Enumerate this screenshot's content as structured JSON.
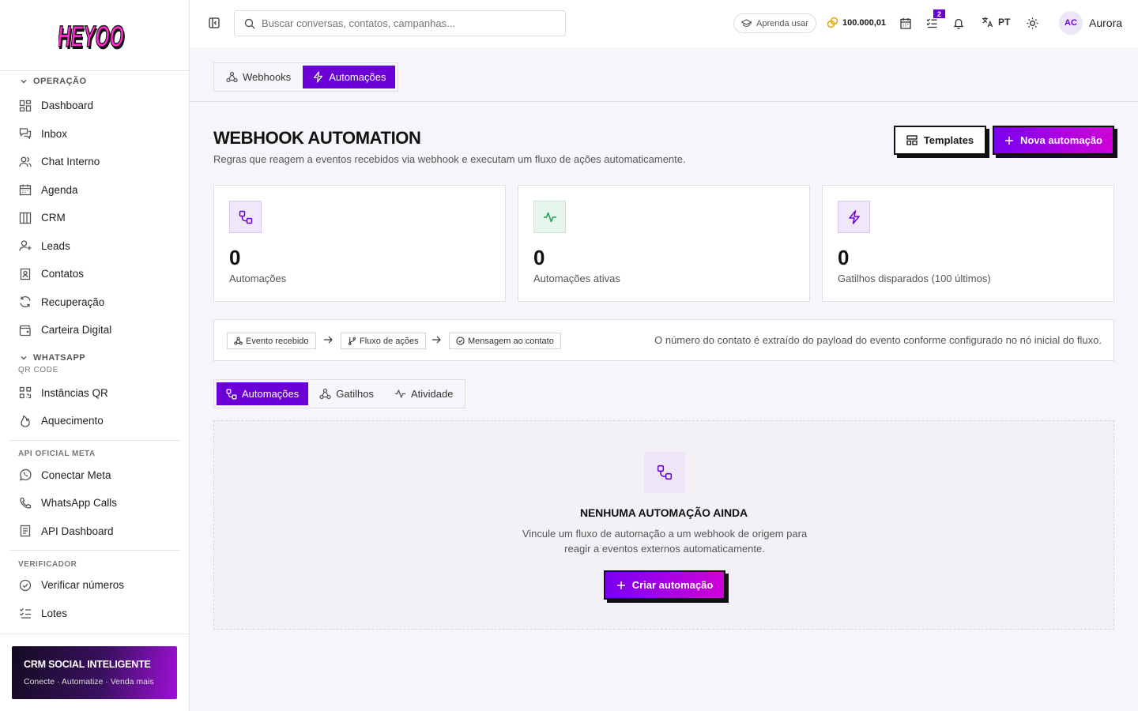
{
  "brand": {
    "logo_text": "HEYOO"
  },
  "sidebar": {
    "operacao": {
      "title": "OPERAÇÃO",
      "items": [
        {
          "label": "Dashboard"
        },
        {
          "label": "Inbox"
        },
        {
          "label": "Chat Interno"
        },
        {
          "label": "Agenda"
        },
        {
          "label": "CRM"
        },
        {
          "label": "Leads"
        },
        {
          "label": "Contatos"
        },
        {
          "label": "Recuperação"
        },
        {
          "label": "Carteira Digital"
        }
      ]
    },
    "whatsapp": {
      "title": "WHATSAPP",
      "sub": "QR CODE",
      "items": [
        {
          "label": "Instâncias QR"
        },
        {
          "label": "Aquecimento"
        }
      ]
    },
    "api": {
      "title": "API OFICIAL META",
      "items": [
        {
          "label": "Conectar Meta"
        },
        {
          "label": "WhatsApp Calls"
        },
        {
          "label": "API Dashboard"
        }
      ]
    },
    "verificador": {
      "title": "VERIFICADOR",
      "items": [
        {
          "label": "Verificar números"
        },
        {
          "label": "Lotes"
        }
      ]
    },
    "promo": {
      "title": "CRM SOCIAL INTELIGENTE",
      "subtitle": "Conecte · Automatize · Venda mais"
    }
  },
  "topbar": {
    "search_placeholder": "Buscar conversas, contatos, campanhas...",
    "learn": "Aprenda usar",
    "coins": "100.000,01",
    "tasks_badge": "2",
    "lang": "PT",
    "user": {
      "initials": "AC",
      "name": "Aurora"
    }
  },
  "top_tabs": [
    {
      "label": "Webhooks",
      "active": false
    },
    {
      "label": "Automações",
      "active": true
    }
  ],
  "page": {
    "title": "WEBHOOK AUTOMATION",
    "description": "Regras que reagem a eventos recebidos via webhook e executam um fluxo de ações automaticamente.",
    "templates_btn": "Templates",
    "new_btn": "Nova automação"
  },
  "stats": [
    {
      "value": "0",
      "label": "Automações"
    },
    {
      "value": "0",
      "label": "Automações ativas"
    },
    {
      "value": "0",
      "label": "Gatilhos disparados (100 últimos)"
    }
  ],
  "flow": {
    "steps": [
      "Evento recebido",
      "Fluxo de ações",
      "Mensagem ao contato"
    ],
    "note": "O número do contato é extraído do payload do evento conforme configurado no nó inicial do fluxo."
  },
  "sub_tabs": [
    {
      "label": "Automações",
      "active": true
    },
    {
      "label": "Gatilhos",
      "active": false
    },
    {
      "label": "Atividade",
      "active": false
    }
  ],
  "empty": {
    "title": "NENHUMA AUTOMAÇÃO AINDA",
    "line1": "Vincule um fluxo de automação a um webhook de origem para",
    "line2": "reagir a eventos externos automaticamente.",
    "cta": "Criar automação"
  },
  "colors": {
    "accent": "#6b00d6",
    "gradient_end": "#d000d8",
    "green": "#1a9e4a"
  }
}
